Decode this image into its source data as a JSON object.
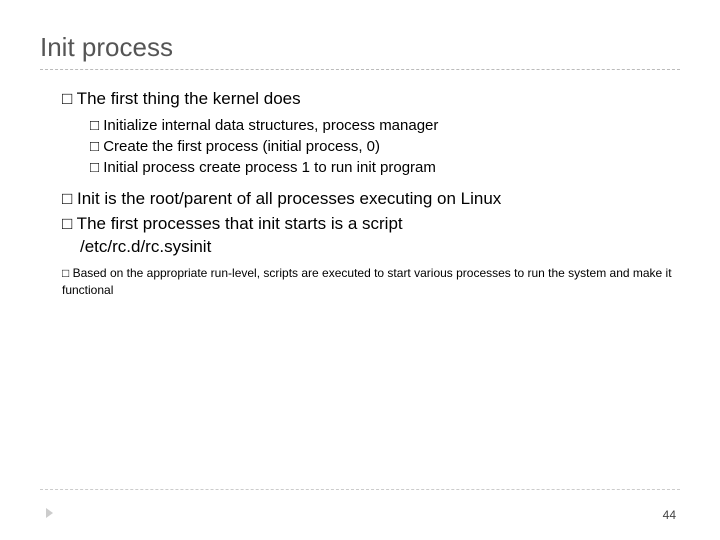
{
  "title": "Init process",
  "bullets": {
    "b1": "□ The first thing the kernel does",
    "b1s": [
      "□ Initialize internal data structures, process manager",
      "□ Create the first process (initial process, 0)",
      "□ Initial process create process 1 to run init program"
    ],
    "b2": "□ Init is the root/parent of all processes executing on Linux",
    "b3a": "□ The first processes that init starts is a script",
    "b3b": "/etc/rc.d/rc.sysinit",
    "b4": "□ Based on the appropriate run-level, scripts are executed to start various processes to run the system and make it functional"
  },
  "page": "44"
}
